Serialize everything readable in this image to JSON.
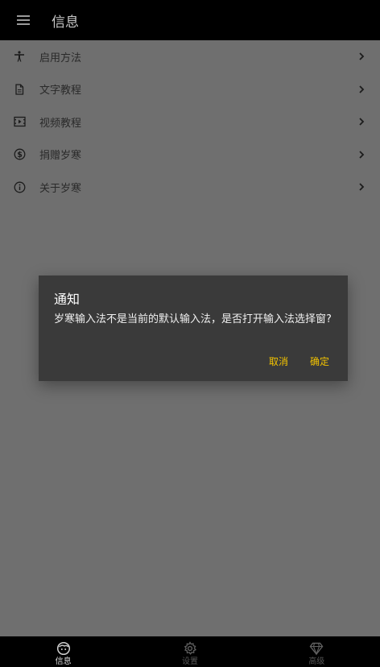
{
  "app_bar": {
    "title": "信息",
    "menu_icon": "hamburger-menu-icon"
  },
  "list": {
    "items": [
      {
        "label": "启用方法",
        "icon": "accessibility-icon"
      },
      {
        "label": "文字教程",
        "icon": "document-icon"
      },
      {
        "label": "视频教程",
        "icon": "video-icon"
      },
      {
        "label": "捐赠岁寒",
        "icon": "dollar-circle-icon"
      },
      {
        "label": "关于岁寒",
        "icon": "info-circle-icon"
      }
    ]
  },
  "dialog": {
    "title": "通知",
    "message": "岁寒输入法不是当前的默认输入法，是否打开输入法选择窗?",
    "cancel_label": "取消",
    "confirm_label": "确定",
    "accent_color": "#f3c300"
  },
  "bottom_nav": {
    "items": [
      {
        "label": "信息",
        "icon": "face-icon",
        "active": true
      },
      {
        "label": "设置",
        "icon": "gear-icon",
        "active": false
      },
      {
        "label": "高级",
        "icon": "diamond-icon",
        "active": false
      }
    ]
  }
}
